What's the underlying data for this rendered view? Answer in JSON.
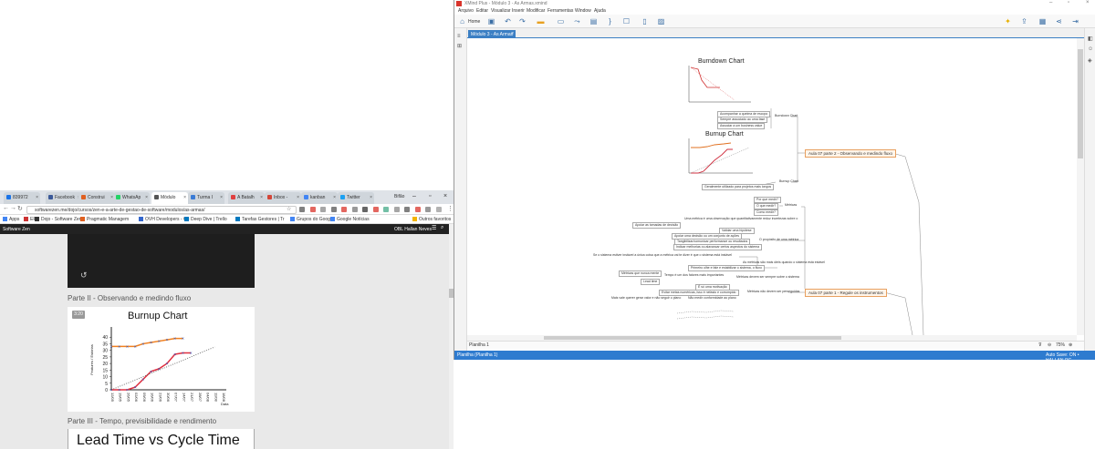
{
  "browser": {
    "tabs": [
      {
        "label": "839972",
        "color": "#1a73e8"
      },
      {
        "label": "Facebook",
        "color": "#3b5998"
      },
      {
        "label": "Construi",
        "color": "#e06020"
      },
      {
        "label": "WhatsAp",
        "color": "#25d366"
      },
      {
        "label": "Módulo",
        "color": "#555555"
      },
      {
        "label": "Turma I",
        "color": "#3a7bd5"
      },
      {
        "label": "A Batalh",
        "color": "#e04040"
      },
      {
        "label": "Inbox -",
        "color": "#d44638"
      },
      {
        "label": "kanban",
        "color": "#4285f4"
      },
      {
        "label": "Twitter",
        "color": "#1da1f2"
      }
    ],
    "active_tab_index": 4,
    "user_label": "Bifão",
    "url": "softwarezen.me/dojo/cursos/zen-e-a-arte-de-gestao-de-software/modulos/as-armas/",
    "bookmarks": [
      "Apps",
      "EF",
      "Dojo - Software Zen",
      "Pragmatic Managem",
      "OVH Developers - Co",
      "Deep Dive | Trello",
      "Tarefas Gestores | Tr",
      "Grupos do Google",
      "Google Notícias",
      "Outros favoritos"
    ],
    "site": {
      "name": "Software Zen",
      "user": "OBL Hallan Neves",
      "parts": [
        "Parte II - Observando e medindo fluxo",
        "Parte III - Tempo, previsibilidade e rendimento"
      ],
      "duration_badge": "3:20",
      "lead_time_title": "Lead Time vs Cycle Time"
    }
  },
  "burnup_chart": {
    "chart_data": {
      "type": "line",
      "title": "Burnup Chart",
      "ylabel": "Features / Estórias",
      "xlabel": "Data",
      "ylim": [
        0,
        45
      ],
      "yticks": [
        0,
        5,
        10,
        15,
        20,
        25,
        30,
        35,
        40
      ],
      "categories": [
        "12/05",
        "19/05",
        "26/05",
        "02/06",
        "09/06",
        "16/06",
        "23/06",
        "30/06",
        "07/07",
        "14/07",
        "21/07",
        "28/07",
        "04/08",
        "11/08",
        "18/08"
      ],
      "series": [
        {
          "values": [
            33,
            33,
            33,
            33,
            35,
            36,
            37,
            38,
            39,
            39,
            null,
            null,
            null,
            null,
            null
          ],
          "color": "#f08020"
        },
        {
          "values": [
            0,
            0,
            0,
            2,
            8,
            14,
            16,
            20,
            27,
            28,
            28,
            null,
            null,
            null,
            null
          ],
          "color": "#e03040"
        },
        {
          "values": [
            0,
            2.5,
            5,
            7.5,
            10,
            12.5,
            15,
            17.5,
            20,
            22.5,
            25,
            27.5,
            30,
            32.5,
            null
          ],
          "color": "#555555",
          "style": "dotted"
        }
      ],
      "grid": false
    }
  },
  "xmind": {
    "window_title": "XMind Plus - Módulo 3 - As Armas.xmind",
    "menu": [
      "Arquivo",
      "Editar",
      "Visualizar",
      "Inserir",
      "Modificar",
      "Ferramentas",
      "Window",
      "Ajuda"
    ],
    "toolbar_home": "Home",
    "doc_tab": "Módulo 3 - As Armas",
    "sheet_label": "Planilha 1",
    "zoom": "75%",
    "status_left": "Planilha (Planilha 1)",
    "status_right": "Auto Save: ON  •  HALLAN-PC",
    "map": {
      "burndown_title": "Burndown Chart",
      "burnup_title": "Burnup Chart",
      "burndown_nodes": [
        "Acompanhar a queima de escopo",
        "Sempre associado ao uma fase",
        "Associar a um business value"
      ],
      "burndown_label": "Burndown Chart",
      "burnup_label": "Burnup Chart",
      "burnup_note": "Geralmente utilizado para projetos mais longos",
      "topic_flow": "Aula 07 parte 2 - Observando e medindo fluxo",
      "topic_instruments": "Aula 07 parte 1 - Regule os instrumentos",
      "metrics_nodes": [
        "Por que medir?",
        "O que medir?",
        "Como medir?"
      ],
      "metrics_label": "Métricas",
      "left_nodes": [
        "Uma métrica é uma observação que quantitativamente reduz incertezas sobre o",
        "Apoiar as tomadas de decisão",
        "Validar uma hipótese",
        "Apoiar uma decisão ou um conjunto de ações",
        "Tangibilizar/comunicar performance ou resultados",
        "Indicar melhorias ou alavancar certos aspectos do sistema",
        "Se o sistema estiver instável a única coisa que a métrica vai te dizer é que o sistema está instável",
        "As métricas são mais úteis quando o sistema está estável",
        "Primeiro olhe e fale e estabilizar o sistema, o fluxo",
        "Métricas que nunca mente",
        "Tempo é um dos fatores mais importantes",
        "Métricas devem ser sempre sobre o sistema",
        "Lead time",
        "É só uma motivação",
        "Evitar metas numéricas, isso é nefasto e corrompido",
        "Mais vale querer gerar valor e não seguir o plano",
        "Não medir conformidade ao plano",
        "Métricas não devem ser perseguidas"
      ],
      "purpose_label": "O propósito de uma métrica"
    }
  }
}
